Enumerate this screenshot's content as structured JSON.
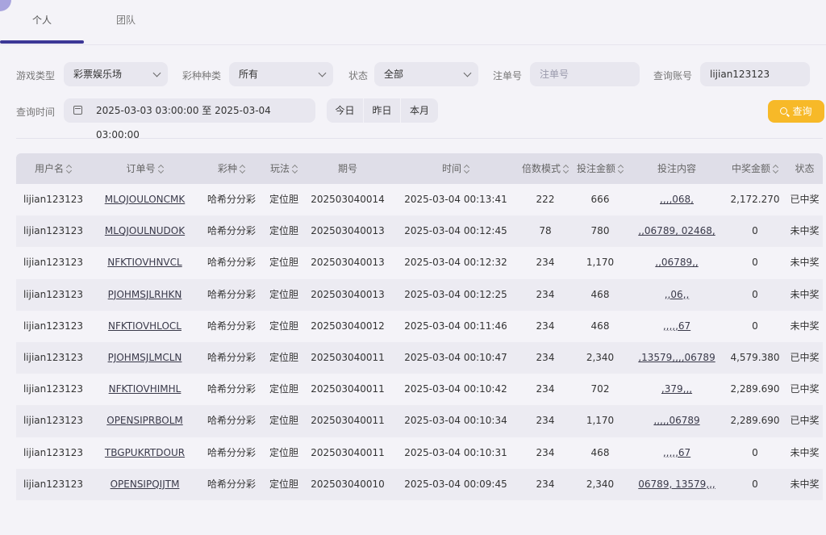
{
  "tabs": [
    {
      "label": "个人"
    },
    {
      "label": "团队"
    }
  ],
  "filters": {
    "game_type": {
      "label": "游戏类型",
      "value": "彩票娱乐场"
    },
    "lottery_type": {
      "label": "彩种种类",
      "value": "所有"
    },
    "status": {
      "label": "状态",
      "value": "全部"
    },
    "order_no": {
      "label": "注单号",
      "placeholder": "注单号"
    },
    "account": {
      "label": "查询账号",
      "value": "lijian123123"
    },
    "time": {
      "label": "查询时间",
      "value": "2025-03-03 03:00:00 至 2025-03-04 03:00:00"
    },
    "quick_range": [
      "今日",
      "昨日",
      "本月"
    ],
    "query_button": "查询"
  },
  "table": {
    "headers": [
      "用户名",
      "订单号",
      "彩种",
      "玩法",
      "期号",
      "时间",
      "倍数模式",
      "投注金额",
      "投注内容",
      "中奖金额",
      "状态"
    ],
    "rows": [
      [
        "lijian123123",
        "MLQJOULONCMK",
        "哈希分分彩",
        "定位胆",
        "202503040014",
        "2025-03-04 00:13:41",
        "222",
        "666",
        ",,,,068,",
        "2,172.270",
        "已中奖"
      ],
      [
        "lijian123123",
        "MLQJOULNUDOK",
        "哈希分分彩",
        "定位胆",
        "202503040013",
        "2025-03-04 00:12:45",
        "78",
        "780",
        ",,06789, 02468,",
        "0",
        "未中奖"
      ],
      [
        "lijian123123",
        "NFKTIOVHNVCL",
        "哈希分分彩",
        "定位胆",
        "202503040013",
        "2025-03-04 00:12:32",
        "234",
        "1,170",
        ",,06789,,",
        "0",
        "未中奖"
      ],
      [
        "lijian123123",
        "PJOHMSJLRHKN",
        "哈希分分彩",
        "定位胆",
        "202503040013",
        "2025-03-04 00:12:25",
        "234",
        "468",
        ",,06,,",
        "0",
        "未中奖"
      ],
      [
        "lijian123123",
        "NFKTIOVHLOCL",
        "哈希分分彩",
        "定位胆",
        "202503040012",
        "2025-03-04 00:11:46",
        "234",
        "468",
        ",,,,,67",
        "0",
        "未中奖"
      ],
      [
        "lijian123123",
        "PJOHMSJLMCLN",
        "哈希分分彩",
        "定位胆",
        "202503040011",
        "2025-03-04 00:10:47",
        "234",
        "2,340",
        ",13579,,,,06789",
        "4,579.380",
        "已中奖"
      ],
      [
        "lijian123123",
        "NFKTIOVHIMHL",
        "哈希分分彩",
        "定位胆",
        "202503040011",
        "2025-03-04 00:10:42",
        "234",
        "702",
        ",379,,,",
        "2,289.690",
        "已中奖"
      ],
      [
        "lijian123123",
        "OPENSIPRBOLM",
        "哈希分分彩",
        "定位胆",
        "202503040011",
        "2025-03-04 00:10:34",
        "234",
        "1,170",
        ",,,,,06789",
        "2,289.690",
        "已中奖"
      ],
      [
        "lijian123123",
        "TBGPUKRTDOUR",
        "哈希分分彩",
        "定位胆",
        "202503040011",
        "2025-03-04 00:10:31",
        "234",
        "468",
        ",,,,,67",
        "0",
        "未中奖"
      ],
      [
        "lijian123123",
        "OPENSIPQIJTM",
        "哈希分分彩",
        "定位胆",
        "202503040010",
        "2025-03-04 00:09:45",
        "234",
        "2,340",
        "06789, 13579,,,",
        "0",
        "未中奖"
      ]
    ]
  },
  "colors": {
    "accent": "#3c3796",
    "query_button": "#f7b928",
    "header_bg": "#dfdee8"
  }
}
